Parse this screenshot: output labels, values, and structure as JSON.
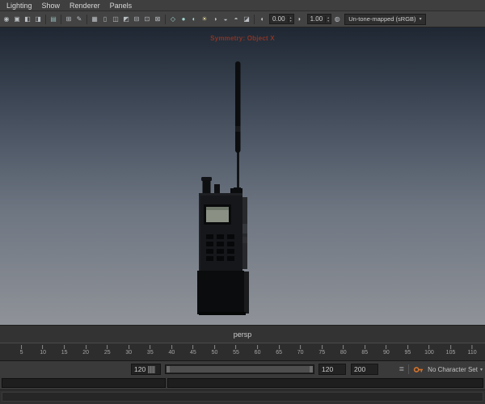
{
  "panel_menu": {
    "items": [
      "Lighting",
      "Show",
      "Renderer",
      "Panels"
    ]
  },
  "toolbar": {
    "icons": [
      {
        "name": "select-camera-icon",
        "glyph": "◉",
        "color": "#b9bec2"
      },
      {
        "name": "lock-camera-icon",
        "glyph": "▣",
        "color": "#b9bec2"
      },
      {
        "name": "camera-attributes-icon",
        "glyph": "◧",
        "color": "#b9bec2"
      },
      {
        "name": "bookmarks-icon",
        "glyph": "◨",
        "color": "#b9bec2"
      },
      {
        "sep": true
      },
      {
        "name": "image-plane-icon",
        "glyph": "▤",
        "color": "#8fb7b3"
      },
      {
        "sep": true
      },
      {
        "name": "2d-pan-zoom-icon",
        "glyph": "⊞",
        "color": "#b9bec2"
      },
      {
        "name": "grease-pencil-icon",
        "glyph": "✎",
        "color": "#b9bec2"
      },
      {
        "sep": true
      },
      {
        "name": "grid-icon",
        "glyph": "▦",
        "color": "#b9bec2"
      },
      {
        "name": "film-gate-icon",
        "glyph": "▯",
        "color": "#b9bec2"
      },
      {
        "name": "resolution-gate-icon",
        "glyph": "◫",
        "color": "#b9bec2"
      },
      {
        "name": "gate-mask-icon",
        "glyph": "◩",
        "color": "#b9bec2"
      },
      {
        "name": "field-chart-icon",
        "glyph": "⊟",
        "color": "#b9bec2"
      },
      {
        "name": "safe-action-icon",
        "glyph": "⊡",
        "color": "#b9bec2"
      },
      {
        "name": "safe-title-icon",
        "glyph": "⊠",
        "color": "#b9bec2"
      },
      {
        "sep": true
      },
      {
        "name": "wireframe-icon",
        "glyph": "◇",
        "color": "#9fd3cd"
      },
      {
        "name": "shaded-display-icon",
        "glyph": "●",
        "color": "#9fd3cd"
      },
      {
        "name": "textured-display-icon",
        "glyph": "◐",
        "color": "#9fd3cd"
      },
      {
        "name": "lights-icon",
        "glyph": "☀",
        "color": "#d6cf9e"
      },
      {
        "name": "shadows-icon",
        "glyph": "◑",
        "color": "#b9bec2"
      },
      {
        "name": "screen-space-ao-icon",
        "glyph": "◒",
        "color": "#b9bec2"
      },
      {
        "name": "motion-blur-icon",
        "glyph": "◓",
        "color": "#b9bec2"
      },
      {
        "name": "xray-icon",
        "glyph": "◪",
        "color": "#b9bec2"
      }
    ],
    "exposure_value": "0.00",
    "gamma_value": "1.00",
    "view_transform": "Un-tone-mapped (sRGB)"
  },
  "viewport": {
    "hud_message": "Symmetry: Object X",
    "camera_label": "persp"
  },
  "timeline": {
    "tick_labels": [
      5,
      10,
      15,
      20,
      25,
      30,
      35,
      40,
      45,
      50,
      55,
      60,
      65,
      70,
      75,
      80,
      85,
      90,
      95,
      100,
      105,
      110
    ],
    "axis_max": 113
  },
  "range_slider": {
    "left_field": "120",
    "range_end_field": "120",
    "playback_end_field": "200",
    "character_set_label": "No Character Set"
  },
  "colors": {
    "viewport_gradient": [
      "#1f2733",
      "#46505f",
      "#6e7682",
      "#8f9298"
    ],
    "hud_text": "#8a3526",
    "autokey_accent": "#d4722c",
    "lcd_screen": "#8a9184"
  }
}
